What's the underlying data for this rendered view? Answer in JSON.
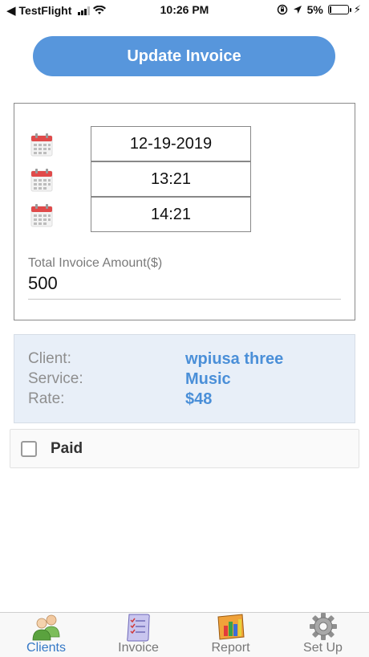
{
  "status_bar": {
    "back_label": "TestFlight",
    "time": "10:26 PM",
    "battery_percent": "5%",
    "battery_level": 0.05
  },
  "actions": {
    "update_label": "Update Invoice"
  },
  "invoice": {
    "date": "12-19-2019",
    "start_time": "13:21",
    "end_time": "14:21",
    "total_label": "Total Invoice Amount($)",
    "total_value": "500"
  },
  "details": {
    "client_label": "Client:",
    "client_value": "wpiusa three",
    "service_label": "Service:",
    "service_value": "Music",
    "rate_label": "Rate:",
    "rate_value": "$48"
  },
  "paid": {
    "label": "Paid",
    "checked": false
  },
  "tabs": [
    {
      "label": "Clients",
      "icon": "clients-icon",
      "active": true
    },
    {
      "label": "Invoice",
      "icon": "invoice-icon",
      "active": false
    },
    {
      "label": "Report",
      "icon": "report-icon",
      "active": false
    },
    {
      "label": "Set Up",
      "icon": "gear-icon",
      "active": false
    }
  ],
  "colors": {
    "accent": "#5796dc",
    "value_blue": "#4a8fd8",
    "panel_bg": "#e8eff8",
    "active_tab": "#3478c6"
  }
}
